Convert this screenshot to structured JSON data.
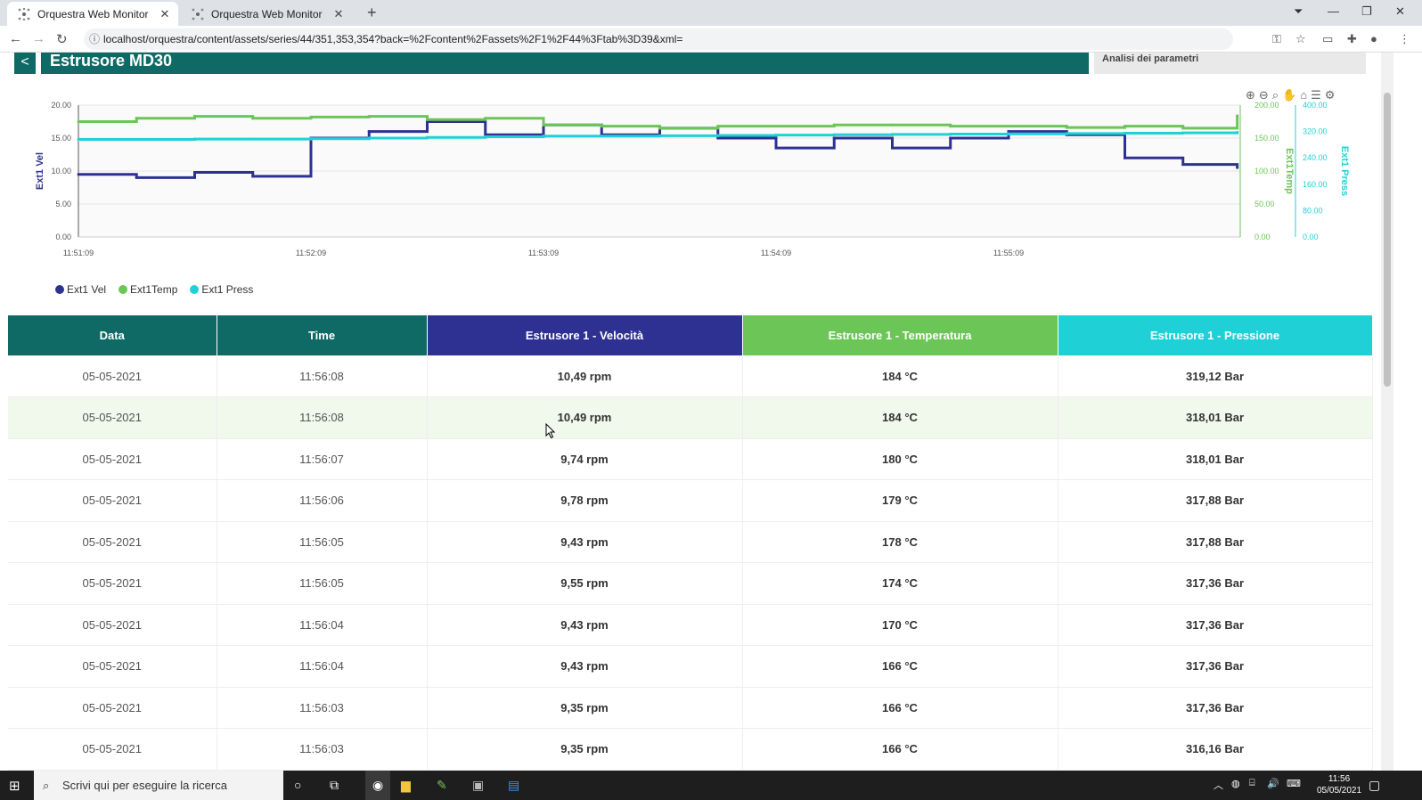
{
  "browser": {
    "tabs": [
      {
        "title": "Orquestra Web Monitor",
        "active": true
      },
      {
        "title": "Orquestra Web Monitor",
        "active": false
      }
    ],
    "url": "localhost/orquestra/content/assets/series/44/351,353,354?back=%2Fcontent%2Fassets%2F1%2F44%3Ftab%3D39&xml="
  },
  "page": {
    "title": "Estrusore MD30",
    "side_panel_title": "Analisi dei parametri"
  },
  "colors": {
    "teal_dark": "#0f6a66",
    "vel": "#2e3192",
    "temp": "#6cc557",
    "press": "#1fd1d6"
  },
  "legend": [
    "Ext1 Vel",
    "Ext1Temp",
    "Ext1 Press"
  ],
  "chart_data": {
    "type": "line",
    "x_ticks": [
      "11:51:09",
      "11:52:09",
      "11:53:09",
      "11:54:09",
      "11:55:09"
    ],
    "axes": {
      "y_left": {
        "label": "Ext1 Vel",
        "ticks": [
          "0.00",
          "5.00",
          "10.00",
          "15.00",
          "20.00"
        ],
        "range": [
          0,
          20
        ]
      },
      "y_right1": {
        "label": "Ext1Temp",
        "ticks": [
          "0.00",
          "50.00",
          "100.00",
          "150.00",
          "200.00"
        ],
        "range": [
          0,
          200
        ]
      },
      "y_right2": {
        "label": "Ext1 Press",
        "ticks": [
          "0.00",
          "80.00",
          "160.00",
          "240.00",
          "320.00",
          "400.00"
        ],
        "range": [
          0,
          400
        ]
      }
    },
    "series": [
      {
        "name": "Ext1 Vel",
        "axis": "y_left",
        "x": [
          "11:51:09",
          "11:51:24",
          "11:51:39",
          "11:51:54",
          "11:52:09",
          "11:52:24",
          "11:52:39",
          "11:52:54",
          "11:53:09",
          "11:53:24",
          "11:53:39",
          "11:53:54",
          "11:54:09",
          "11:54:24",
          "11:54:39",
          "11:54:54",
          "11:55:09",
          "11:55:24",
          "11:55:39",
          "11:55:54",
          "11:56:08"
        ],
        "values": [
          9.5,
          9.0,
          9.8,
          9.2,
          15.0,
          16.0,
          17.5,
          15.5,
          17.0,
          15.5,
          16.5,
          15.0,
          13.5,
          15.0,
          13.5,
          15.0,
          16.0,
          15.5,
          12.0,
          11.0,
          10.5
        ]
      },
      {
        "name": "Ext1Temp",
        "axis": "y_right1",
        "x": [
          "11:51:09",
          "11:51:24",
          "11:51:39",
          "11:51:54",
          "11:52:09",
          "11:52:24",
          "11:52:39",
          "11:52:54",
          "11:53:09",
          "11:53:24",
          "11:53:39",
          "11:53:54",
          "11:54:09",
          "11:54:24",
          "11:54:39",
          "11:54:54",
          "11:55:09",
          "11:55:24",
          "11:55:39",
          "11:55:54",
          "11:56:08"
        ],
        "values": [
          175,
          180,
          183,
          180,
          182,
          183,
          178,
          180,
          170,
          168,
          165,
          168,
          168,
          170,
          170,
          168,
          168,
          166,
          168,
          165,
          184
        ]
      },
      {
        "name": "Ext1 Press",
        "axis": "y_right2",
        "x": [
          "11:51:09",
          "11:51:24",
          "11:51:39",
          "11:51:54",
          "11:52:09",
          "11:52:24",
          "11:52:39",
          "11:52:54",
          "11:53:09",
          "11:53:24",
          "11:53:39",
          "11:53:54",
          "11:54:09",
          "11:54:24",
          "11:54:39",
          "11:54:54",
          "11:55:09",
          "11:55:24",
          "11:55:39",
          "11:55:54",
          "11:56:08"
        ],
        "values": [
          296,
          296,
          297,
          297,
          298,
          300,
          302,
          304,
          306,
          306,
          307,
          308,
          309,
          310,
          311,
          312,
          313,
          314,
          315,
          316,
          318
        ]
      }
    ]
  },
  "table": {
    "headers": [
      "Data",
      "Time",
      "Estrusore 1 - Velocità",
      "Estrusore 1 - Temperatura",
      "Estrusore 1 - Pressione"
    ],
    "rows": [
      [
        "05-05-2021",
        "11:56:08",
        "10,49 rpm",
        "184 °C",
        "319,12 Bar"
      ],
      [
        "05-05-2021",
        "11:56:08",
        "10,49 rpm",
        "184 °C",
        "318,01 Bar"
      ],
      [
        "05-05-2021",
        "11:56:07",
        "9,74 rpm",
        "180 °C",
        "318,01 Bar"
      ],
      [
        "05-05-2021",
        "11:56:06",
        "9,78 rpm",
        "179 °C",
        "317,88 Bar"
      ],
      [
        "05-05-2021",
        "11:56:05",
        "9,43 rpm",
        "178 °C",
        "317,88 Bar"
      ],
      [
        "05-05-2021",
        "11:56:05",
        "9,55 rpm",
        "174 °C",
        "317,36 Bar"
      ],
      [
        "05-05-2021",
        "11:56:04",
        "9,43 rpm",
        "170 °C",
        "317,36 Bar"
      ],
      [
        "05-05-2021",
        "11:56:04",
        "9,43 rpm",
        "166 °C",
        "317,36 Bar"
      ],
      [
        "05-05-2021",
        "11:56:03",
        "9,35 rpm",
        "166 °C",
        "317,36 Bar"
      ],
      [
        "05-05-2021",
        "11:56:03",
        "9,35 rpm",
        "166 °C",
        "316,16 Bar"
      ]
    ]
  },
  "taskbar": {
    "search_placeholder": "Scrivi qui per eseguire la ricerca",
    "time": "11:56",
    "date": "05/05/2021"
  }
}
